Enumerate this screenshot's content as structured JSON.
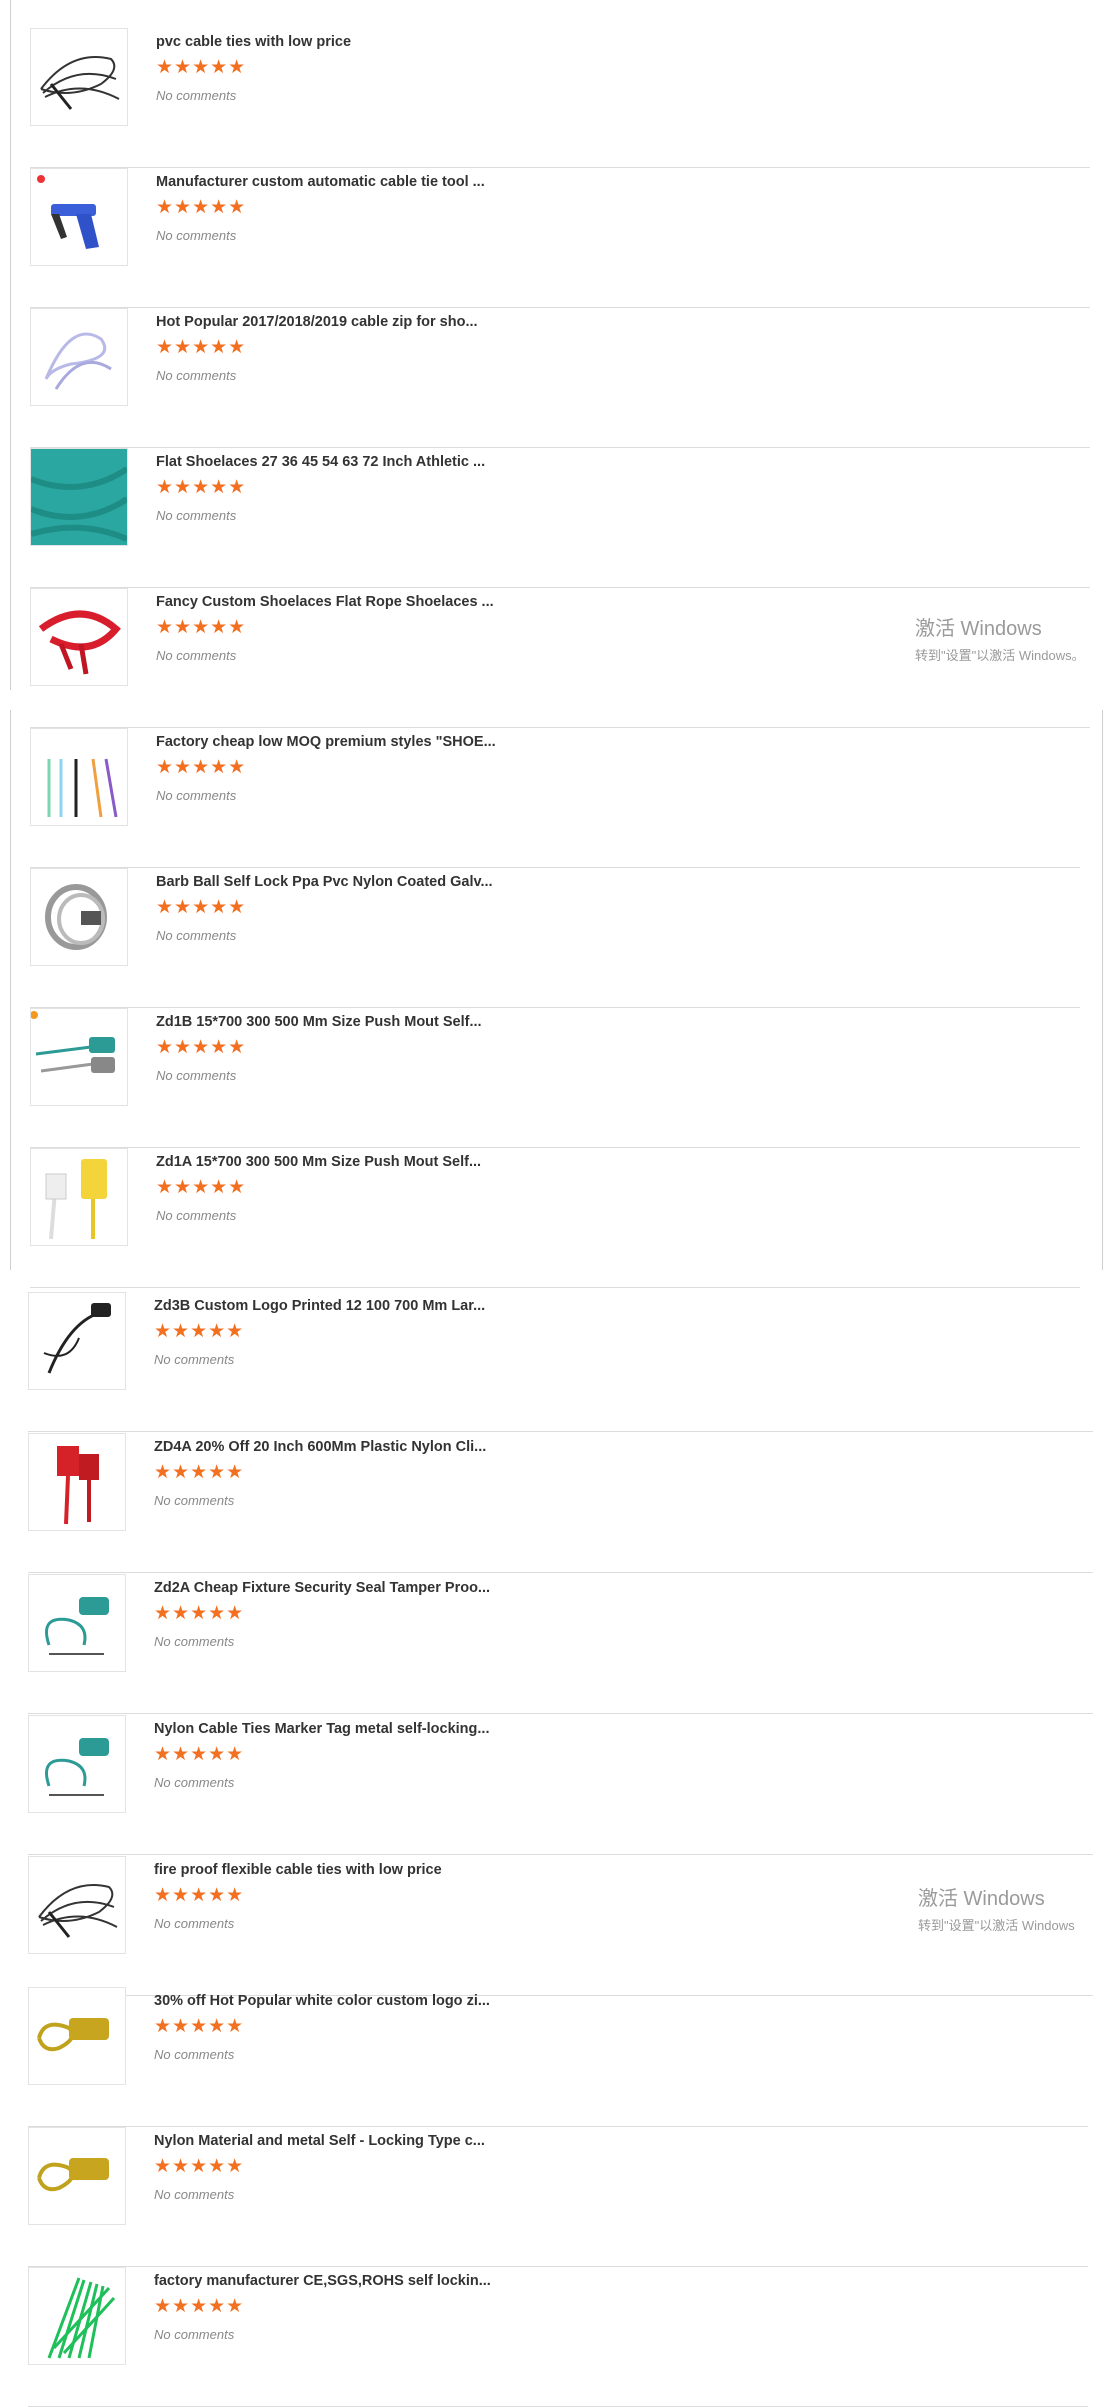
{
  "items": [
    {
      "title": "pvc cable ties with low price",
      "rating": "★★★★★",
      "comments": "No comments",
      "icon": "black-cable-ties-image"
    },
    {
      "title": "Manufacturer custom automatic cable tie tool ...",
      "rating": "★★★★★",
      "comments": "No comments",
      "icon": "cable-tie-gun-image"
    },
    {
      "title": "Hot Popular 2017/2018/2019 cable zip for sho...",
      "rating": "★★★★★",
      "comments": "No comments",
      "icon": "clear-zip-ties-image"
    },
    {
      "title": "Flat Shoelaces 27 36 45 54 63 72 Inch Athletic ...",
      "rating": "★★★★★",
      "comments": "No comments",
      "icon": "teal-shoelaces-image"
    },
    {
      "title": "Fancy Custom Shoelaces Flat Rope Shoelaces ...",
      "rating": "★★★★★",
      "comments": "No comments",
      "icon": "red-shoelaces-image"
    },
    {
      "title": "Factory cheap low MOQ premium styles \"SHOE...",
      "rating": "★★★★★",
      "comments": "No comments",
      "icon": "colored-laces-image"
    },
    {
      "title": "Barb Ball Self Lock Ppa Pvc Nylon Coated Galv...",
      "rating": "★★★★★",
      "comments": "No comments",
      "icon": "steel-tie-coil-image"
    },
    {
      "title": "Zd1B 15*700 300 500 Mm Size Push Mout Self...",
      "rating": "★★★★★",
      "comments": "No comments",
      "icon": "teal-grey-seals-image"
    },
    {
      "title": "Zd1A 15*700 300 500 Mm Size Push Mout Self...",
      "rating": "★★★★★",
      "comments": "No comments",
      "icon": "yellow-white-seals-image"
    },
    {
      "title": "Zd3B Custom Logo Printed 12 100 700 Mm Lar...",
      "rating": "★★★★★",
      "comments": "No comments",
      "icon": "black-seal-image"
    },
    {
      "title": "ZD4A 20% Off 20 Inch 600Mm Plastic Nylon Cli...",
      "rating": "★★★★★",
      "comments": "No comments",
      "icon": "red-tags-image"
    },
    {
      "title": "Zd2A Cheap Fixture Security Seal Tamper Proo...",
      "rating": "★★★★★",
      "comments": "No comments",
      "icon": "teal-seal-image"
    },
    {
      "title": "Nylon Cable Ties Marker Tag metal self-locking...",
      "rating": "★★★★★",
      "comments": "No comments",
      "icon": "teal-seal-image"
    },
    {
      "title": "fire proof flexible cable ties with low price",
      "rating": "★★★★★",
      "comments": "No comments",
      "icon": "black-cable-ties-image"
    },
    {
      "title": "30% off Hot Popular white color custom logo zi...",
      "rating": "★★★★★",
      "comments": "No comments",
      "icon": "yellow-seal-image"
    },
    {
      "title": "Nylon Material and metal Self - Locking Type c...",
      "rating": "★★★★★",
      "comments": "No comments",
      "icon": "yellow-seal-image"
    },
    {
      "title": "factory manufacturer CE,SGS,ROHS self lockin...",
      "rating": "★★★★★",
      "comments": "No comments",
      "icon": "green-cable-ties-image"
    }
  ],
  "watermarks": [
    {
      "line1": "激活 Windows",
      "line2": "转到\"设置\"以激活 Windows。"
    },
    {
      "line1": "激活 Windows",
      "line2": "转到\"设置\"以激活 Windows"
    }
  ],
  "colors": {
    "star": "#f37021",
    "separator": "#dcdcdc"
  }
}
